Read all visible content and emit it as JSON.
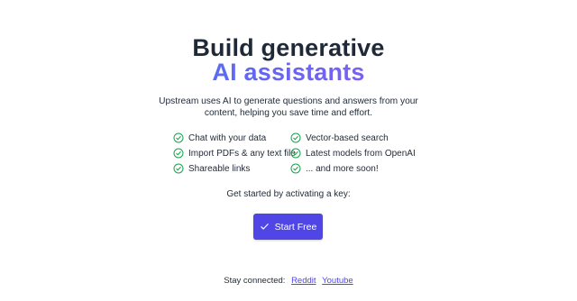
{
  "hero": {
    "title_line1": "Build generative",
    "title_line2": "AI assistants",
    "description": "Upstream uses AI to generate questions and answers from your content, helping you save time and effort."
  },
  "features": {
    "items": [
      "Chat with your data",
      "Import PDFs & any text file",
      "Shareable links",
      "Vector-based search",
      "Latest models from OpenAI",
      "... and more soon!"
    ],
    "icon": "check-circle-icon",
    "icon_color": "#16a34a"
  },
  "cta": {
    "prompt": "Get started by activating a key:",
    "button_label": "Start Free",
    "button_icon": "checkmark-icon",
    "button_color": "#4f46e5"
  },
  "footer": {
    "label": "Stay connected:",
    "links": [
      "Reddit",
      "Youtube"
    ]
  },
  "colors": {
    "gradient_start": "#3b82f6",
    "gradient_end": "#a855f7",
    "text": "#1f2937"
  }
}
